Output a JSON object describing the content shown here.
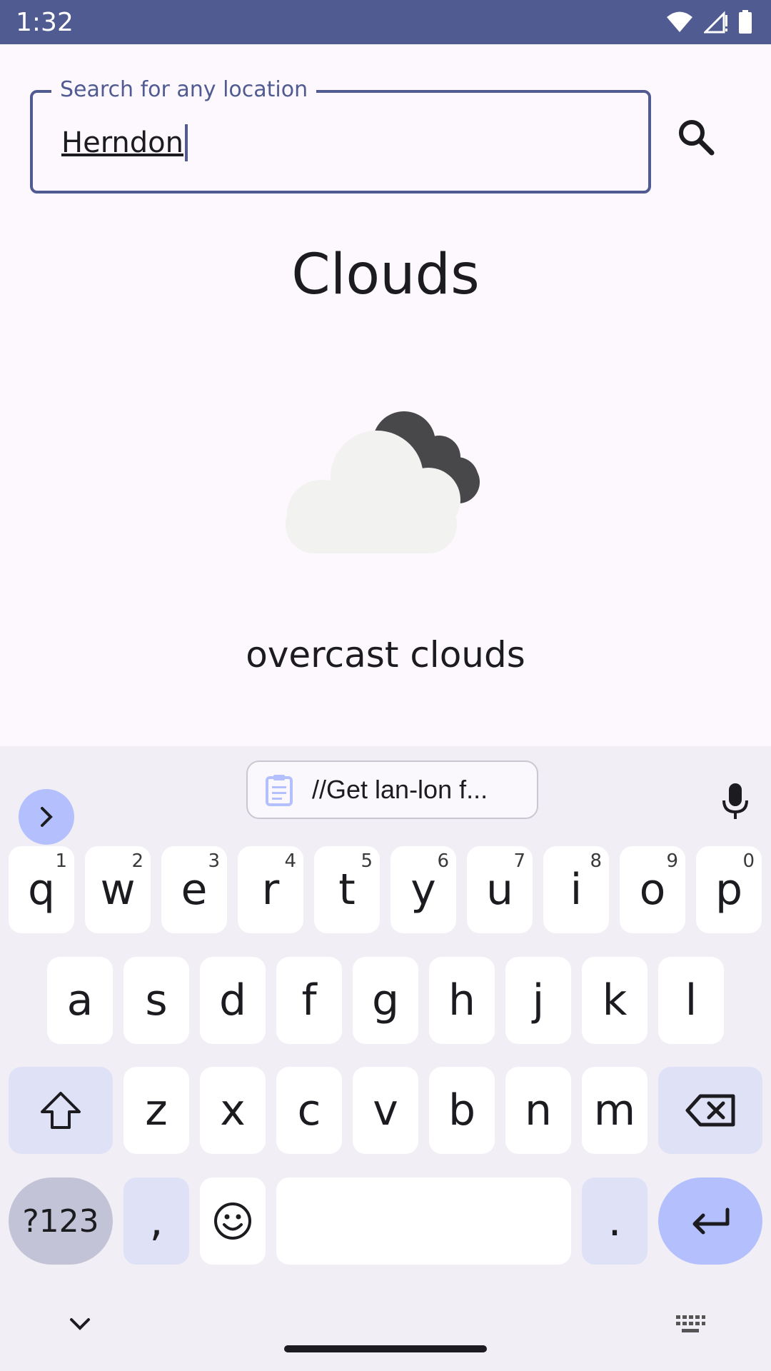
{
  "status_bar": {
    "time": "1:32"
  },
  "search": {
    "label": "Search for any location",
    "value": "Herndon"
  },
  "weather": {
    "main": "Clouds",
    "description": "overcast clouds",
    "icon": "overcast-cloud-icon"
  },
  "keyboard": {
    "clipboard_text": "//Get lan-lon f...",
    "row1": [
      {
        "key": "q",
        "hint": "1"
      },
      {
        "key": "w",
        "hint": "2"
      },
      {
        "key": "e",
        "hint": "3"
      },
      {
        "key": "r",
        "hint": "4"
      },
      {
        "key": "t",
        "hint": "5"
      },
      {
        "key": "y",
        "hint": "6"
      },
      {
        "key": "u",
        "hint": "7"
      },
      {
        "key": "i",
        "hint": "8"
      },
      {
        "key": "o",
        "hint": "9"
      },
      {
        "key": "p",
        "hint": "0"
      }
    ],
    "row2": [
      "a",
      "s",
      "d",
      "f",
      "g",
      "h",
      "j",
      "k",
      "l"
    ],
    "row3": [
      "z",
      "x",
      "c",
      "v",
      "b",
      "n",
      "m"
    ],
    "symbols_label": "?123",
    "comma_label": ",",
    "period_label": "."
  },
  "colors": {
    "primary": "#505b92",
    "keyboard_bg": "#f1eff5",
    "accent_key": "#b4c0fd"
  }
}
